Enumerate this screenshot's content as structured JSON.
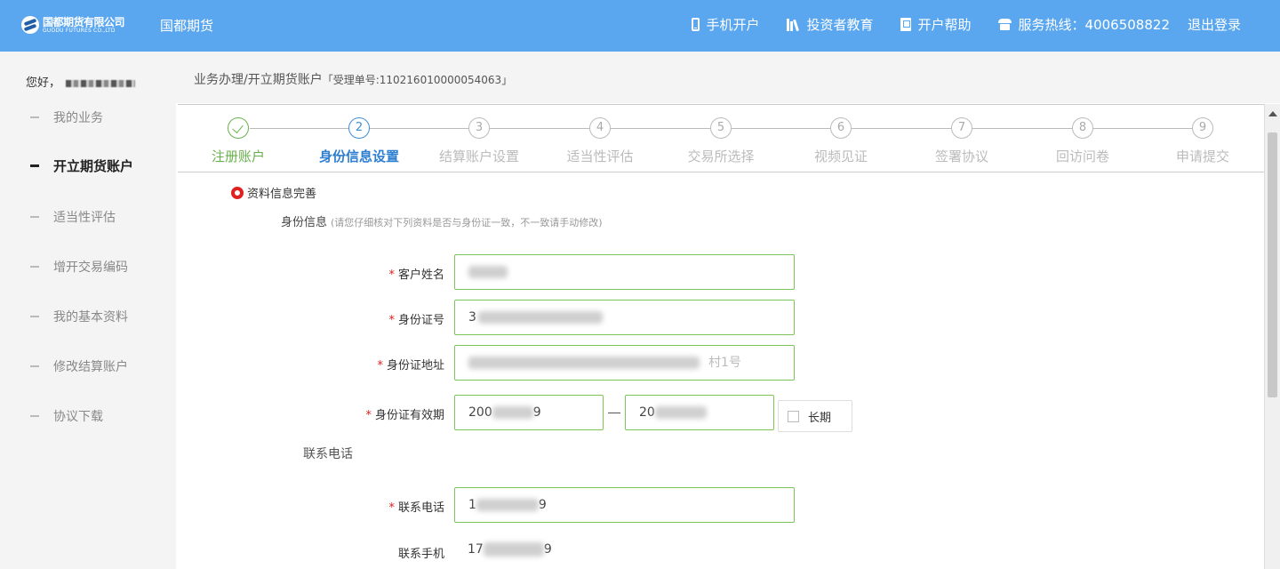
{
  "header": {
    "logo_cn": "国都期货有限公司",
    "logo_en": "GUODU FUTURES CO.,LTD",
    "brand": "国都期货",
    "nav": [
      {
        "label": "手机开户",
        "icon": "mobile-icon"
      },
      {
        "label": "投资者教育",
        "icon": "books-icon"
      },
      {
        "label": "开户帮助",
        "icon": "book-icon"
      },
      {
        "label": "服务热线：4006508822",
        "icon": "telephone-icon"
      }
    ],
    "logout": "退出登录",
    "bg_color": "#5aa7ef"
  },
  "sidebar": {
    "greeting": "您好，",
    "items": [
      {
        "label": "我的业务"
      },
      {
        "label": "开立期货账户",
        "active": true
      },
      {
        "label": "适当性评估"
      },
      {
        "label": "增开交易编码"
      },
      {
        "label": "我的基本资料"
      },
      {
        "label": "修改结算账户"
      },
      {
        "label": "协议下载"
      }
    ]
  },
  "breadcrumb": {
    "path": "业务办理/开立期货账户",
    "ticket": "「受理单号:110216010000054063」"
  },
  "steps": [
    {
      "num": "1",
      "label": "注册账户",
      "state": "done"
    },
    {
      "num": "2",
      "label": "身份信息设置",
      "state": "current"
    },
    {
      "num": "3",
      "label": "结算账户设置",
      "state": "todo"
    },
    {
      "num": "4",
      "label": "适当性评估",
      "state": "todo"
    },
    {
      "num": "5",
      "label": "交易所选择",
      "state": "todo"
    },
    {
      "num": "6",
      "label": "视频见证",
      "state": "todo"
    },
    {
      "num": "7",
      "label": "签署协议",
      "state": "todo"
    },
    {
      "num": "8",
      "label": "回访问卷",
      "state": "todo"
    },
    {
      "num": "9",
      "label": "申请提交",
      "state": "todo"
    }
  ],
  "form": {
    "section_title": "资料信息完善",
    "identity_title": "身份信息",
    "identity_hint": "(请您仔细核对下列资料是否与身份证一致，不一致请手动修改)",
    "required_mark": "*",
    "fields": {
      "name": {
        "label": "客户姓名",
        "visible_value": ""
      },
      "id_number": {
        "label": "身份证号",
        "visible_value": "3"
      },
      "id_address": {
        "label": "身份证地址",
        "visible_value": "",
        "suffix": "村1号"
      },
      "id_validity": {
        "label": "身份证有效期",
        "start_visible": "200",
        "start_end": "9",
        "end_visible": "20",
        "long_term_label": "长期",
        "long_term_checked": false
      }
    },
    "contact_title": "联系电话",
    "phone": {
      "label": "联系电话",
      "visible_start": "1",
      "visible_end": "9"
    },
    "mobile": {
      "label": "联系手机",
      "visible_start": "17",
      "visible_end": "9"
    }
  },
  "colors": {
    "done_green": "#6ab04c",
    "current_blue": "#2f7fd0",
    "required_red": "#e02020",
    "field_border": "#7cc35a"
  }
}
